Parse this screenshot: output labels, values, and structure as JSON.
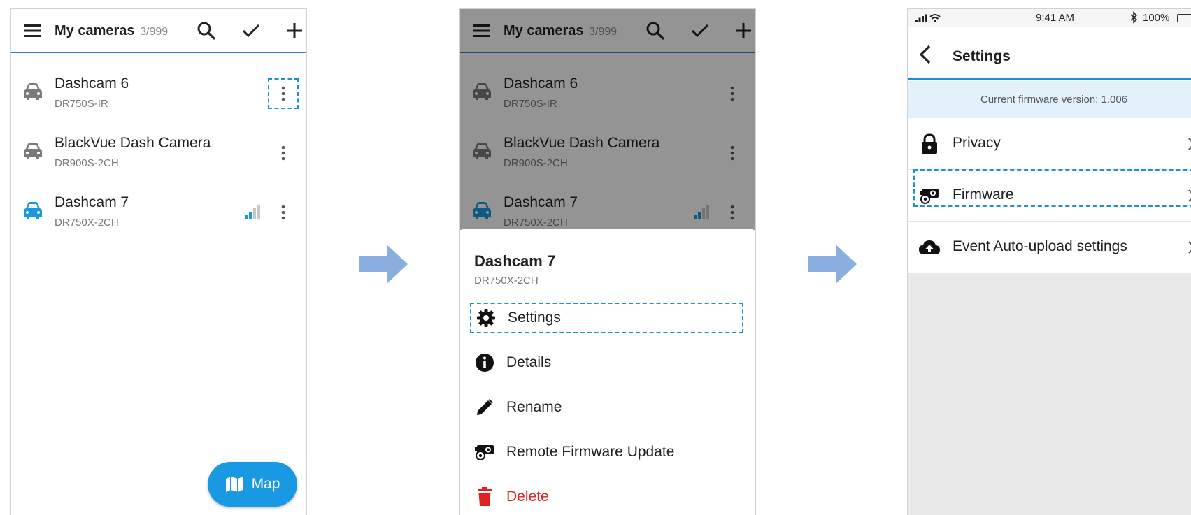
{
  "screen1": {
    "title": "My cameras",
    "count": "3/999",
    "cameras": [
      {
        "name": "Dashcam 6",
        "model": "DR750S-IR",
        "icon": "car-icon",
        "color": "#7a7a7a"
      },
      {
        "name": "BlackVue Dash Camera",
        "model": "DR900S-2CH",
        "icon": "car-icon",
        "color": "#7a7a7a"
      },
      {
        "name": "Dashcam 7",
        "model": "DR750X-2CH",
        "icon": "car-icon",
        "color": "#1899e2"
      }
    ],
    "fab_label": "Map"
  },
  "screen2": {
    "title": "My cameras",
    "count": "3/999",
    "cameras": [
      {
        "name": "Dashcam 6",
        "model": "DR750S-IR"
      },
      {
        "name": "BlackVue Dash Camera",
        "model": "DR900S-2CH"
      },
      {
        "name": "Dashcam 7",
        "model": "DR750X-2CH"
      }
    ],
    "sheet": {
      "title": "Dashcam 7",
      "subtitle": "DR750X-2CH",
      "items": [
        {
          "label": "Settings",
          "icon": "gear-icon"
        },
        {
          "label": "Details",
          "icon": "info-icon"
        },
        {
          "label": "Rename",
          "icon": "pencil-icon"
        },
        {
          "label": "Remote Firmware Update",
          "icon": "firmware-icon"
        },
        {
          "label": "Delete",
          "icon": "trash-icon"
        }
      ]
    }
  },
  "screen3": {
    "status": {
      "time": "9:41 AM",
      "battery": "100%"
    },
    "title": "Settings",
    "firmware_banner": "Current firmware version: 1.006",
    "items": [
      {
        "label": "Privacy",
        "icon": "lock-icon"
      },
      {
        "label": "Firmware",
        "icon": "firmware-icon"
      },
      {
        "label": "Event Auto-upload settings",
        "icon": "cloud-upload-icon"
      }
    ]
  },
  "colors": {
    "accent": "#1899e2",
    "highlight": "#1b8fd9",
    "delete": "#e02020",
    "arrow": "#8aaedf"
  }
}
